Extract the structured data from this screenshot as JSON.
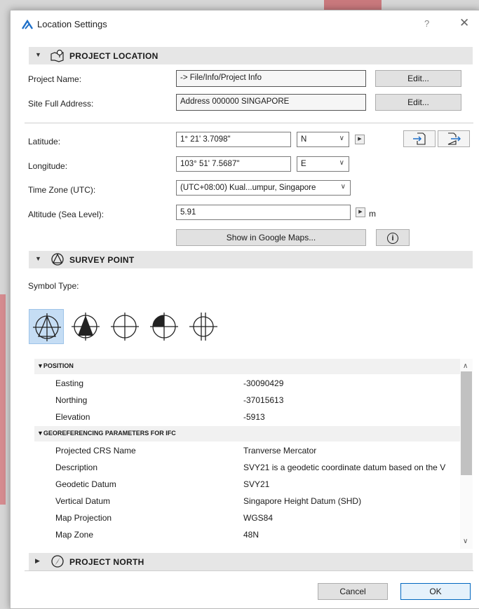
{
  "window": {
    "title": "Location Settings",
    "help": "?",
    "close": "✕"
  },
  "project_location": {
    "title": "PROJECT LOCATION",
    "project_name_label": "Project Name:",
    "project_name_value": "-> File/Info/Project Info",
    "site_address_label": "Site Full Address:",
    "site_address_value": "Address 000000 SINGAPORE",
    "edit_label": "Edit...",
    "latitude_label": "Latitude:",
    "latitude_value": "1° 21' 3.7098\"",
    "latitude_dir": "N",
    "longitude_label": "Longitude:",
    "longitude_value": "103° 51' 7.5687\"",
    "longitude_dir": "E",
    "timezone_label": "Time Zone (UTC):",
    "timezone_value": "(UTC+08:00) Kual...umpur, Singapore",
    "altitude_label": "Altitude (Sea Level):",
    "altitude_value": "5.91",
    "altitude_unit": "m",
    "google_maps_label": "Show in Google Maps...",
    "info_glyph": "i"
  },
  "survey_point": {
    "title": "SURVEY POINT",
    "symbol_type_label": "Symbol Type:",
    "symbols": [
      "symbol-1",
      "symbol-2",
      "symbol-3",
      "symbol-4",
      "symbol-5"
    ],
    "selected_symbol": 1,
    "position_group": "POSITION",
    "rows_position": [
      {
        "key": "Easting",
        "value": "-30090429"
      },
      {
        "key": "Northing",
        "value": "-37015613"
      },
      {
        "key": "Elevation",
        "value": "-5913"
      }
    ],
    "georef_group": "GEOREFERENCING PARAMETERS FOR IFC",
    "rows_georef": [
      {
        "key": "Projected CRS Name",
        "value": "Tranverse Mercator"
      },
      {
        "key": "Description",
        "value": "SVY21 is a geodetic coordinate datum based on the V"
      },
      {
        "key": "Geodetic Datum",
        "value": "SVY21"
      },
      {
        "key": "Vertical Datum",
        "value": "Singapore Height Datum (SHD)"
      },
      {
        "key": "Map Projection",
        "value": "WGS84"
      },
      {
        "key": "Map Zone",
        "value": "48N"
      }
    ]
  },
  "project_north": {
    "title": "PROJECT NORTH"
  },
  "footer": {
    "cancel": "Cancel",
    "ok": "OK"
  },
  "colors": {
    "accent": "#0067c0",
    "selected_bg": "#c5ddf4",
    "section_bg": "#e6e6e6"
  }
}
